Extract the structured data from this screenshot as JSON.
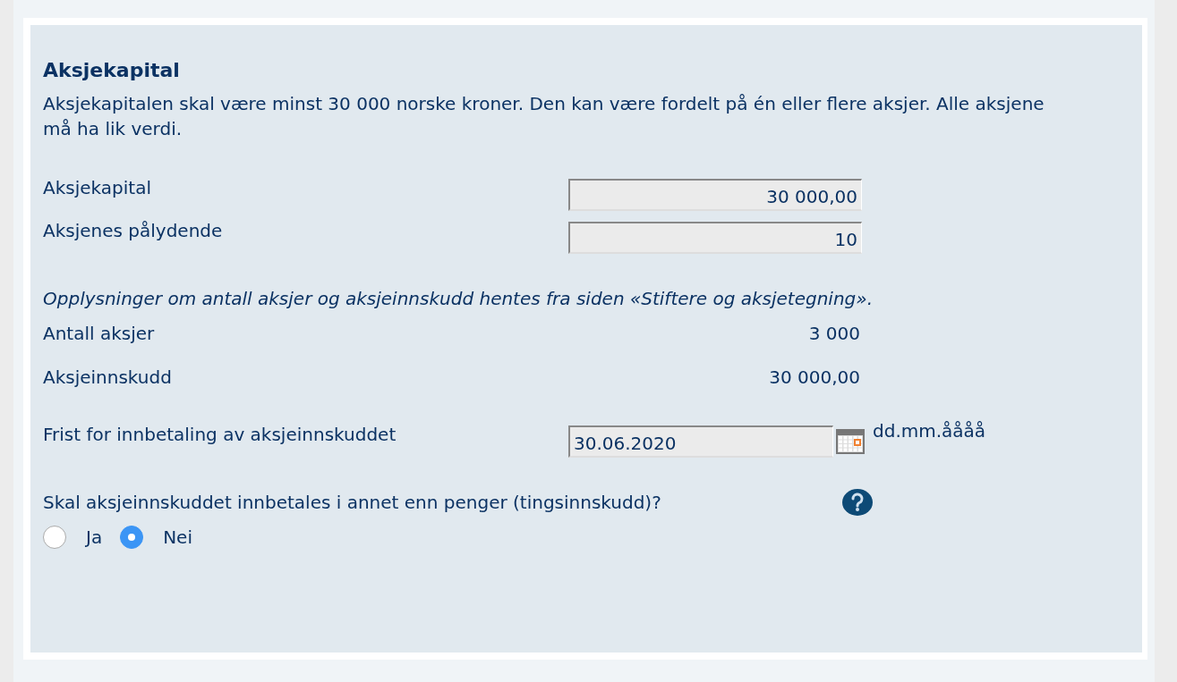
{
  "section": {
    "title": "Aksjekapital",
    "intro": "Aksjekapitalen skal være minst 30 000 norske kroner. Den kan være fordelt på én eller flere aksjer. Alle aksjene må ha lik verdi."
  },
  "inputs": [
    {
      "label": "Aksjekapital",
      "value": "30 000,00"
    },
    {
      "label": "Aksjenes pålydende",
      "value": "10"
    }
  ],
  "info_note": "Opplysninger om antall aksjer og aksjeinnskudd hentes fra siden «Stiftere og aksjetegning».",
  "readonly": [
    {
      "label": "Antall aksjer",
      "value": "3 000"
    },
    {
      "label": "Aksjeinnskudd",
      "value": "30 000,00"
    }
  ],
  "deadline": {
    "label": "Frist for innbetaling av aksjeinnskuddet",
    "value": "30.06.2020",
    "format_hint": "dd.mm.åååå"
  },
  "question": {
    "label": "Skal aksjeinnskuddet innbetales i annet enn penger (tingsinnskudd)?",
    "options": [
      {
        "label": "Ja",
        "selected": false
      },
      {
        "label": "Nei",
        "selected": true
      }
    ]
  }
}
